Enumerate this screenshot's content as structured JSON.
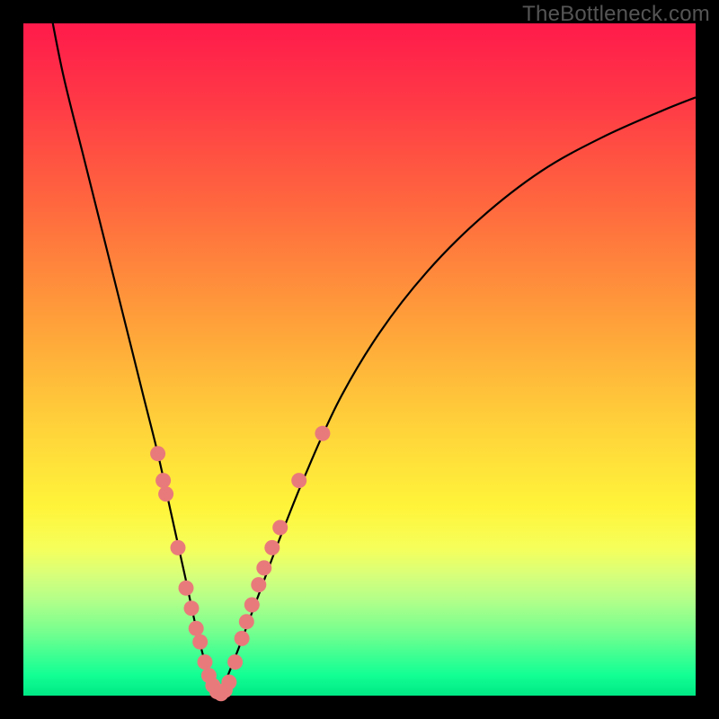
{
  "watermark": "TheBottleneck.com",
  "colors": {
    "frame": "#000000",
    "gradient_top": "#ff1a4b",
    "gradient_mid": "#ffd23a",
    "gradient_bottom": "#00e884",
    "curve": "#000000",
    "dots": "#e97a7b"
  },
  "chart_data": {
    "type": "line",
    "title": "",
    "xlabel": "",
    "ylabel": "",
    "xlim": [
      0,
      100
    ],
    "ylim": [
      0,
      100
    ],
    "series": [
      {
        "name": "bottleneck-curve",
        "x": [
          4,
          6,
          9,
          12,
          15,
          18,
          20,
          22,
          24,
          25.5,
          27,
          28,
          29,
          30,
          32,
          35,
          38,
          42,
          47,
          53,
          60,
          68,
          77,
          86,
          95,
          100
        ],
        "y": [
          102,
          92,
          80,
          68,
          56,
          44,
          36,
          27,
          18,
          11,
          5,
          2,
          0,
          2,
          7,
          15,
          23,
          33,
          44,
          54,
          63,
          71,
          78,
          83,
          87,
          89
        ]
      }
    ],
    "scatter_points": {
      "name": "highlighted-dots",
      "points": [
        {
          "x": 20.0,
          "y": 36
        },
        {
          "x": 20.8,
          "y": 32
        },
        {
          "x": 21.2,
          "y": 30
        },
        {
          "x": 23.0,
          "y": 22
        },
        {
          "x": 24.2,
          "y": 16
        },
        {
          "x": 25.0,
          "y": 13
        },
        {
          "x": 25.7,
          "y": 10
        },
        {
          "x": 26.3,
          "y": 8
        },
        {
          "x": 27.0,
          "y": 5
        },
        {
          "x": 27.6,
          "y": 3
        },
        {
          "x": 28.2,
          "y": 1.5
        },
        {
          "x": 28.8,
          "y": 0.6
        },
        {
          "x": 29.4,
          "y": 0.3
        },
        {
          "x": 30.0,
          "y": 0.8
        },
        {
          "x": 30.6,
          "y": 2
        },
        {
          "x": 31.5,
          "y": 5
        },
        {
          "x": 32.5,
          "y": 8.5
        },
        {
          "x": 33.2,
          "y": 11
        },
        {
          "x": 34.0,
          "y": 13.5
        },
        {
          "x": 35.0,
          "y": 16.5
        },
        {
          "x": 35.8,
          "y": 19
        },
        {
          "x": 37.0,
          "y": 22
        },
        {
          "x": 38.2,
          "y": 25
        },
        {
          "x": 41.0,
          "y": 32
        },
        {
          "x": 44.5,
          "y": 39
        }
      ]
    },
    "annotations": []
  }
}
